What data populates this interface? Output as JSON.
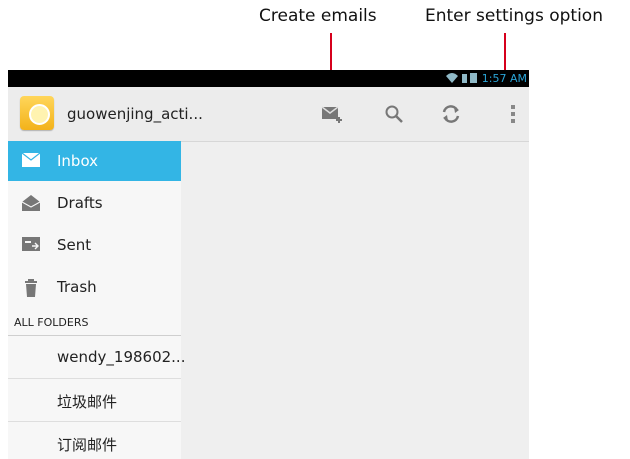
{
  "annotations": {
    "create_label": "Create emails",
    "settings_label": "Enter settings option",
    "line_color": "#d6001c"
  },
  "statusbar": {
    "time": "1:57 AM"
  },
  "actionbar": {
    "account_name": "guowenjing_acti...",
    "actions": [
      "compose-icon",
      "search-icon",
      "refresh-icon",
      "overflow-menu-icon"
    ]
  },
  "sidebar": {
    "items": [
      {
        "label": "Inbox",
        "icon": "inbox-icon",
        "selected": true
      },
      {
        "label": "Drafts",
        "icon": "drafts-icon",
        "selected": false
      },
      {
        "label": "Sent",
        "icon": "sent-icon",
        "selected": false
      },
      {
        "label": "Trash",
        "icon": "trash-icon",
        "selected": false
      }
    ],
    "folders_header": "ALL FOLDERS",
    "folders": [
      "wendy_198602...",
      "垃圾邮件",
      "订阅邮件"
    ]
  },
  "colors": {
    "accent": "#33b5e5",
    "statusbar": "#000000",
    "actionbar": "#ececec"
  }
}
